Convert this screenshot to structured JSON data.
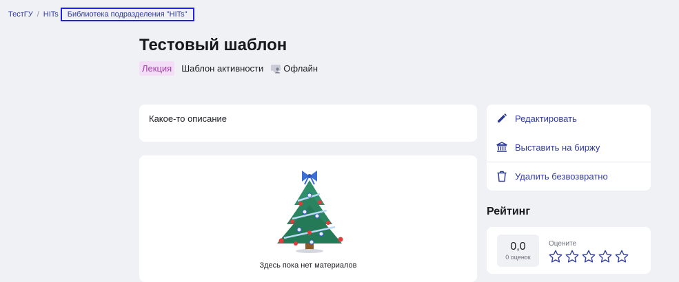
{
  "breadcrumb": {
    "items": [
      "ТестГУ",
      "HITs"
    ],
    "separator": "/",
    "current": "Библиотека подразделения \"HITs\""
  },
  "page": {
    "title": "Тестовый шаблон",
    "tag_type": "Лекция",
    "tag_kind": "Шаблон активности",
    "tag_format": "Офлайн",
    "tag_type_color": "#a03fa8"
  },
  "description": {
    "text": "Какое-то описание"
  },
  "materials": {
    "empty_text": "Здесь пока нет материалов",
    "illustration": "christmas-tree"
  },
  "actions": [
    {
      "label": "Редактировать",
      "icon": "pencil-icon"
    },
    {
      "label": "Выставить на биржу",
      "icon": "bank-icon"
    },
    {
      "label": "Удалить безвозвратно",
      "icon": "trash-icon"
    }
  ],
  "rating": {
    "title": "Рейтинг",
    "value": "0,0",
    "count_label": "0 оценок",
    "rate_label": "Оцените",
    "stars_total": 5,
    "accent_color": "#2f3a9e"
  }
}
